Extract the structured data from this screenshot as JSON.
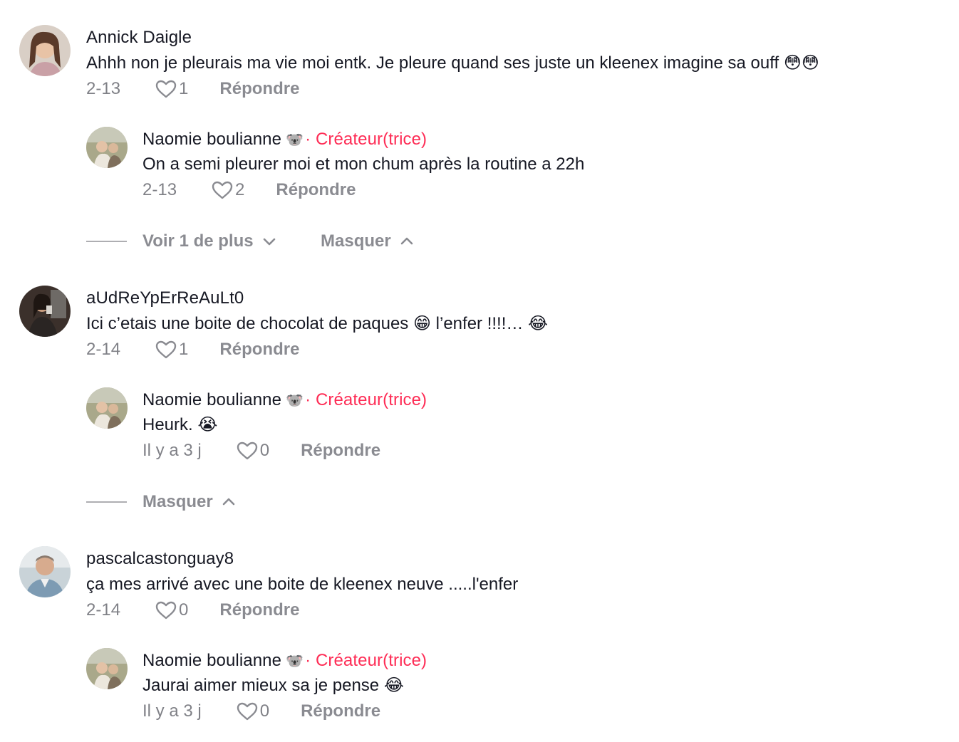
{
  "threads": [
    {
      "author": "Annick Daigle",
      "text": "Ahhh non je pleurais ma vie moi entk. Je pleure quand ses juste un kleenex imagine sa ouff 😳😳",
      "date": "2-13",
      "likes": "1",
      "reply_label": "Répondre",
      "reply": {
        "author": "Naomie boulianne",
        "author_emoji": "🐨",
        "badge": "· Créateur(trice)",
        "text": "On a semi pleurer moi et mon chum après la routine a 22h",
        "date": "2-13",
        "likes": "2",
        "reply_label": "Répondre"
      },
      "view_more_label": "Voir 1 de plus",
      "hide_label": "Masquer"
    },
    {
      "author": "aUdReYpErReAuLt0",
      "text": "Ici c’etais une boite de chocolat de paques 😁 l’enfer !!!!… 😂",
      "date": "2-14",
      "likes": "1",
      "reply_label": "Répondre",
      "reply": {
        "author": "Naomie boulianne",
        "author_emoji": "🐨",
        "badge": "· Créateur(trice)",
        "text": "Heurk. 😭",
        "date": "Il y a 3 j",
        "likes": "0",
        "reply_label": "Répondre"
      },
      "hide_label": "Masquer"
    },
    {
      "author": "pascalcastonguay8",
      "text": "ça mes arrivé avec une boite de kleenex neuve .....l'enfer",
      "date": "2-14",
      "likes": "0",
      "reply_label": "Répondre",
      "reply": {
        "author": "Naomie boulianne",
        "author_emoji": "🐨",
        "badge": "· Créateur(trice)",
        "text": "Jaurai aimer mieux sa je pense 😂",
        "date": "Il y a 3 j",
        "likes": "0",
        "reply_label": "Répondre"
      }
    }
  ],
  "colors": {
    "creator_badge": "#FE2C55",
    "primary_text": "#161823",
    "secondary_text": "#8A8B91"
  },
  "icons": {
    "like": "heart-outline-icon",
    "expand": "chevron-down-icon",
    "collapse": "chevron-up-icon"
  }
}
